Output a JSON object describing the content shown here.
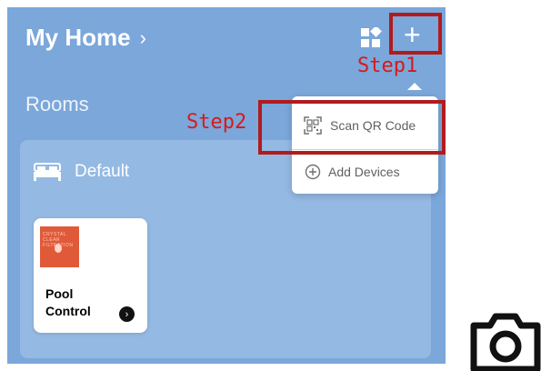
{
  "header": {
    "title": "My Home",
    "chevron": "›",
    "plus": "+"
  },
  "rooms": {
    "title": "Rooms"
  },
  "room": {
    "name": "Default"
  },
  "device": {
    "name": "Pool Control",
    "thumb_text": "CRYSTAL CLEAR FILTRATION",
    "go": "›"
  },
  "menu": {
    "scan": "Scan QR Code",
    "add": "Add Devices"
  },
  "annotations": {
    "step1": "Step1",
    "step2": "Step2"
  },
  "colors": {
    "header_bg": "#7ba7da",
    "card_bg": "#94b9e3",
    "annotation_red": "#b01c1c",
    "step_text": "#d61a1a"
  },
  "icons": {
    "apps": "apps-grid-icon",
    "plus": "plus-icon",
    "bed": "bed-icon",
    "qr": "qr-code-icon",
    "add": "add-circle-icon",
    "camera": "camera-icon"
  }
}
